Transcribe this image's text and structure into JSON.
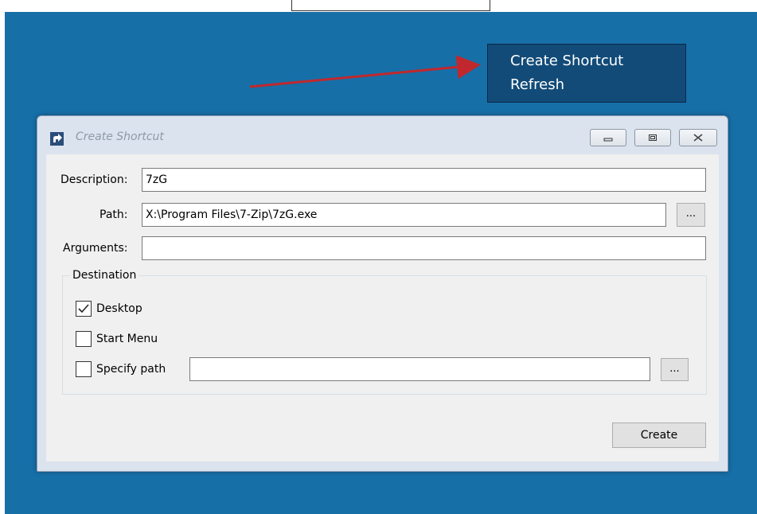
{
  "context_menu": {
    "items": [
      "Create Shortcut",
      "Refresh"
    ]
  },
  "window": {
    "title": "Create Shortcut"
  },
  "form": {
    "description_label": "Description:",
    "description_value": "7zG",
    "path_label": "Path:",
    "path_value": "X:\\Program Files\\7-Zip\\7zG.exe",
    "path_browse_label": "...",
    "arguments_label": "Arguments:",
    "arguments_value": ""
  },
  "destination": {
    "title": "Destination",
    "desktop_label": "Desktop",
    "desktop_checked": true,
    "start_menu_label": "Start Menu",
    "start_menu_checked": false,
    "specify_path_label": "Specify path",
    "specify_path_checked": false,
    "specify_path_value": "",
    "specify_browse_label": "..."
  },
  "actions": {
    "create_label": "Create"
  },
  "colors": {
    "desktop_bg": "#176fa8",
    "menu_bg": "#124b78",
    "arrow": "#c0282d",
    "window_frame": "#dbe3ee"
  },
  "icons": {
    "window_icon": "shortcut-arrow-icon",
    "minimize": "minimize-icon",
    "maximize": "maximize-icon",
    "close": "close-icon",
    "checked": "checkmark-icon"
  }
}
